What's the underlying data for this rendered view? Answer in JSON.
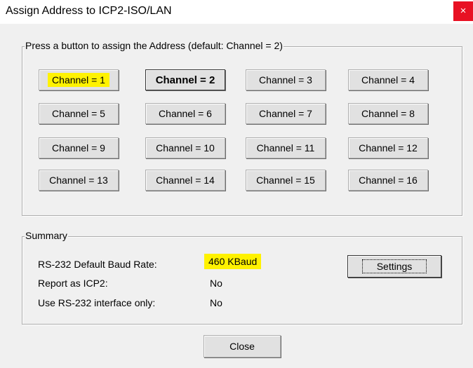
{
  "window": {
    "title": "Assign Address to ICP2-ISO/LAN",
    "close_glyph": "×"
  },
  "channel_group": {
    "label": "Press a button to assign the Address (default: Channel = 2)",
    "buttons": [
      "Channel = 1",
      "Channel = 2",
      "Channel = 3",
      "Channel = 4",
      "Channel = 5",
      "Channel = 6",
      "Channel = 7",
      "Channel = 8",
      "Channel = 9",
      "Channel = 10",
      "Channel = 11",
      "Channel = 12",
      "Channel = 13",
      "Channel = 14",
      "Channel = 15",
      "Channel = 16"
    ],
    "highlighted_button": "Channel = 1",
    "default_button": "Channel = 2"
  },
  "summary": {
    "label": "Summary",
    "rows": [
      {
        "label": "RS-232 Default Baud Rate:",
        "value": "460 KBaud"
      },
      {
        "label": "Report as ICP2:",
        "value": "No"
      },
      {
        "label": "Use RS-232 interface only:",
        "value": "No"
      }
    ],
    "settings_label": "Settings"
  },
  "footer": {
    "close_label": "Close"
  },
  "colors": {
    "highlight": "#fff200",
    "close_button": "#e81123",
    "dialog_bg": "#f0f0f0"
  }
}
